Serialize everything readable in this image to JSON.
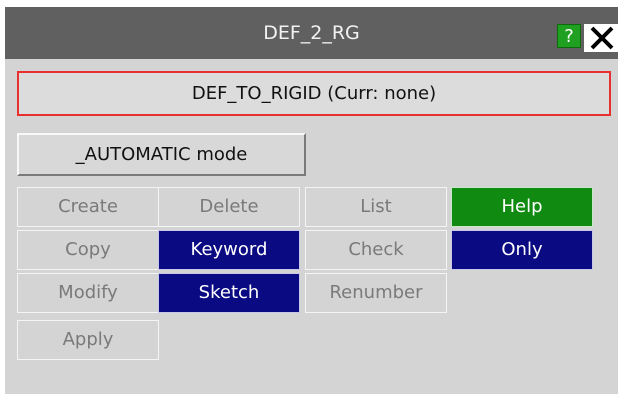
{
  "window": {
    "title": "DEF_2_RG",
    "help_button_label": "?",
    "close_icon": "close-icon"
  },
  "type_box": {
    "label": "DEF_TO_RIGID (Curr: none)",
    "border_color": "#e83030"
  },
  "mode_button": {
    "label": "_AUTOMATIC mode"
  },
  "actions": {
    "create": "Create",
    "delete": "Delete",
    "list": "List",
    "help": "Help",
    "copy": "Copy",
    "keyword": "Keyword",
    "check": "Check",
    "only": "Only",
    "modify": "Modify",
    "sketch": "Sketch",
    "renumber": "Renumber",
    "apply": "Apply"
  },
  "colors": {
    "titlebar": "#606060",
    "panel": "#d4d4d4",
    "active_blue": "#0a0a82",
    "help_green": "#108a10"
  }
}
